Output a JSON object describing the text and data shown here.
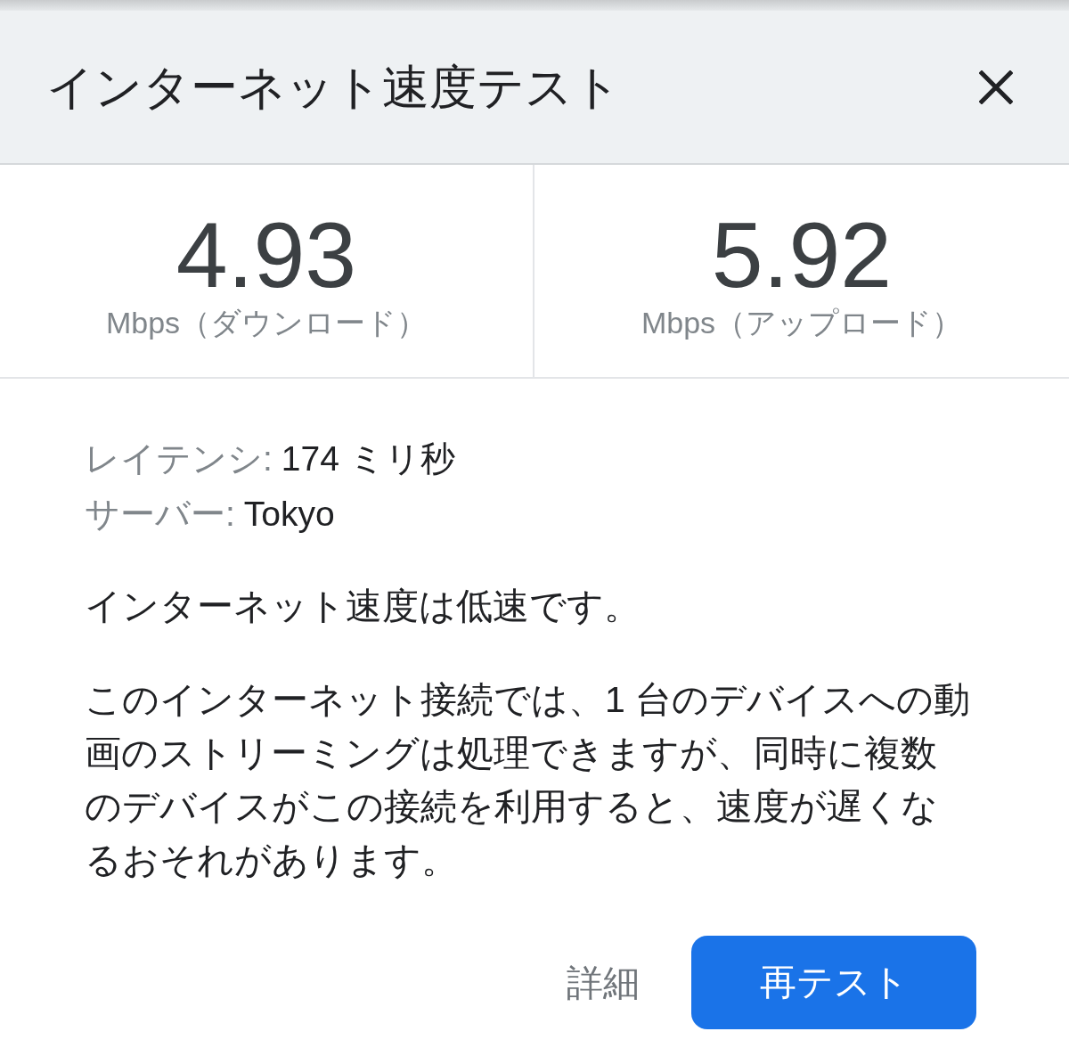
{
  "dialog": {
    "title": "インターネット速度テスト"
  },
  "results": [
    {
      "value": "4.93",
      "unit": "Mbps（ダウンロード）"
    },
    {
      "value": "5.92",
      "unit": "Mbps（アップロード）"
    }
  ],
  "details": [
    {
      "label": "レイテンシ:",
      "value": "174 ミリ秒"
    },
    {
      "label": "サーバー:",
      "value": "Tokyo"
    }
  ],
  "summary": "インターネット速度は低速です。",
  "description": "このインターネット接続では、1 台のデバイスへの動画のストリーミングは処理できますが、同時に複数のデバイスがこの接続を利用すると、速度が遅くなるおそれがあります。",
  "buttons": [
    {
      "label": "詳細",
      "kind": "text"
    },
    {
      "label": "再テスト",
      "kind": "filled"
    }
  ]
}
